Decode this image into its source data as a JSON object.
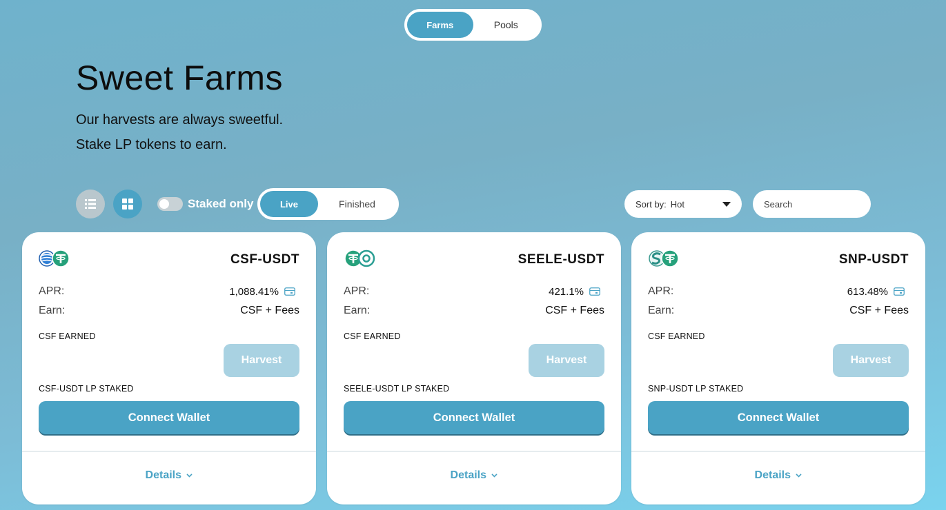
{
  "top_tabs": {
    "farms": "Farms",
    "pools": "Pools"
  },
  "header": {
    "title": "Sweet Farms",
    "subtitle_1": "Our harvests are always sweetful.",
    "subtitle_2": "Stake LP tokens to earn."
  },
  "controls": {
    "staked_only_label": "Staked only",
    "live_label": "Live",
    "finished_label": "Finished",
    "sort_label": "Sort by:",
    "sort_value": "Hot",
    "search_placeholder": "Search"
  },
  "cards": [
    {
      "pair": "CSF-USDT",
      "apr_label": "APR:",
      "apr_value": "1,088.41%",
      "earn_label": "Earn:",
      "earn_value": "CSF + Fees",
      "earned_label": "CSF EARNED",
      "harvest_label": "Harvest",
      "staked_label": "CSF-USDT LP STAKED",
      "connect_label": "Connect Wallet",
      "details_label": "Details"
    },
    {
      "pair": "SEELE-USDT",
      "apr_label": "APR:",
      "apr_value": "421.1%",
      "earn_label": "Earn:",
      "earn_value": "CSF + Fees",
      "earned_label": "CSF EARNED",
      "harvest_label": "Harvest",
      "staked_label": "SEELE-USDT LP STAKED",
      "connect_label": "Connect Wallet",
      "details_label": "Details"
    },
    {
      "pair": "SNP-USDT",
      "apr_label": "APR:",
      "apr_value": "613.48%",
      "earn_label": "Earn:",
      "earn_value": "CSF + Fees",
      "earned_label": "CSF EARNED",
      "harvest_label": "Harvest",
      "staked_label": "SNP-USDT LP STAKED",
      "connect_label": "Connect Wallet",
      "details_label": "Details"
    }
  ],
  "colors": {
    "accent": "#4aa3c5",
    "harvest_disabled": "#a9d2e2",
    "usdt_green": "#26a17b"
  }
}
